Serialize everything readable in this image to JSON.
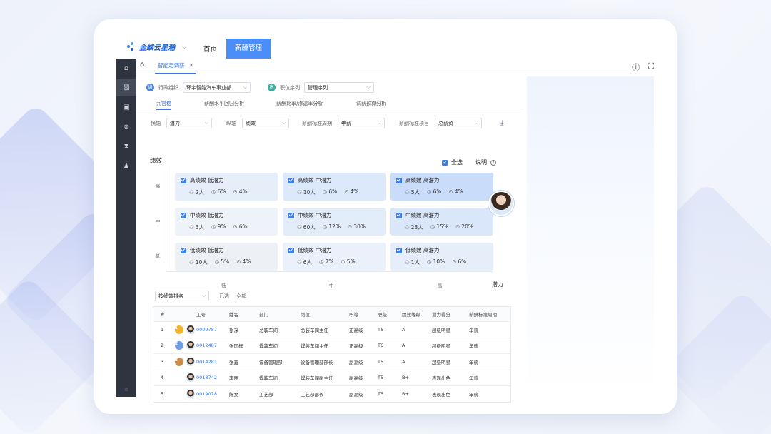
{
  "brand": {
    "name": "金蝶云星瀚"
  },
  "topnav": {
    "home": "首页",
    "active": "薪酬管理"
  },
  "tabs": {
    "active": "智能定调薪"
  },
  "filters": {
    "org_label": "行政组织",
    "org_value": "环宇智能汽车事业部",
    "series_label": "职位序列",
    "series_value": "管理序列"
  },
  "subtabs": [
    "九宫格",
    "薪酬水平回归分析",
    "薪酬比率/渗透率分析",
    "调薪预算分析"
  ],
  "axis": {
    "h_label": "横轴",
    "h_value": "潜力",
    "v_label": "纵轴",
    "v_value": "绩效",
    "period_label": "薪酬标准周期",
    "period_value": "年薪",
    "item_label": "薪酬标准项目",
    "item_value": "总薪资"
  },
  "grid": {
    "title": "绩效",
    "select_all": "全选",
    "explain": "说明",
    "y_labels": [
      "高",
      "中",
      "低"
    ],
    "x_labels": [
      "低",
      "中",
      "高"
    ],
    "x_axis_name": "潜力",
    "cells": [
      {
        "title": "高绩效 低潜力",
        "count": "2人",
        "p1": "6%",
        "p2": "4%",
        "color": "#e6eef9"
      },
      {
        "title": "高绩效 中潜力",
        "count": "10人",
        "p1": "6%",
        "p2": "4%",
        "color": "#dce9fb"
      },
      {
        "title": "高绩效 高潜力",
        "count": "5人",
        "p1": "6%",
        "p2": "4%",
        "color": "#c9dcfa"
      },
      {
        "title": "中绩效 低潜力",
        "count": "3人",
        "p1": "9%",
        "p2": "6%",
        "color": "#eef3f9"
      },
      {
        "title": "中绩效 中潜力",
        "count": "60人",
        "p1": "12%",
        "p2": "30%",
        "color": "#e3edf9"
      },
      {
        "title": "中绩效 高潜力",
        "count": "23人",
        "p1": "15%",
        "p2": "20%",
        "color": "#dae7fa"
      },
      {
        "title": "低绩效 低潜力",
        "count": "10人",
        "p1": "5%",
        "p2": "4%",
        "color": "#edf0f4"
      },
      {
        "title": "低绩效 中潜力",
        "count": "6人",
        "p1": "7%",
        "p2": "5%",
        "color": "#eaf1fa"
      },
      {
        "title": "低绩效 高潜力",
        "count": "1人",
        "p1": "10%",
        "p2": "6%",
        "color": "#e6eef9"
      }
    ]
  },
  "list": {
    "sort_label": "按绩效排名",
    "selected_label": "已选",
    "selected_value": "全部",
    "headers": [
      "#",
      "",
      "工号",
      "姓名",
      "部门",
      "岗位",
      "职等",
      "职级",
      "绩效等级",
      "潜力得分",
      "薪酬标准周期"
    ],
    "rows": [
      {
        "no": "1",
        "medal": "1",
        "id": "0009787",
        "name": "张深",
        "dept": "总装车间",
        "post": "总装车间主任",
        "grade": "正高级",
        "level": "T6",
        "perf": "A",
        "potential": "超级明星",
        "period": "年薪"
      },
      {
        "no": "2",
        "medal": "2",
        "id": "0012487",
        "name": "张国栋",
        "dept": "焊装车间",
        "post": "焊装车间主任",
        "grade": "正高级",
        "level": "T6",
        "perf": "A",
        "potential": "超级明星",
        "period": "年薪"
      },
      {
        "no": "3",
        "medal": "3",
        "id": "0014281",
        "name": "张鑫",
        "dept": "设备管理部",
        "post": "设备管理部部长",
        "grade": "副高级",
        "level": "T5",
        "perf": "A",
        "potential": "超级明星",
        "period": "年薪"
      },
      {
        "no": "4",
        "medal": "",
        "id": "0018742",
        "name": "李丽",
        "dept": "焊装车间",
        "post": "焊装车间副主任",
        "grade": "副高级",
        "level": "T5",
        "perf": "B+",
        "potential": "表现出色",
        "period": "年薪"
      },
      {
        "no": "5",
        "medal": "",
        "id": "0019078",
        "name": "陈文",
        "dept": "工艺部",
        "post": "工艺部部长",
        "grade": "副高级",
        "level": "T5",
        "perf": "B+",
        "potential": "表现出色",
        "period": "年薪"
      }
    ]
  },
  "colors": {
    "accent": "#4b8ef7",
    "sidebar": "#2f3540"
  }
}
